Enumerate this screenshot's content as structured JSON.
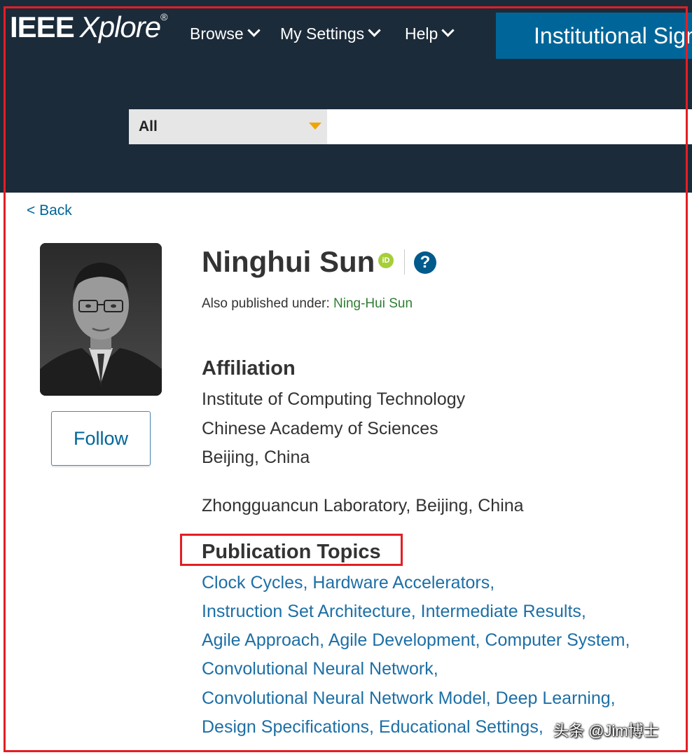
{
  "header": {
    "logo_ieee": "IEEE",
    "logo_xplore": "Xplore",
    "logo_reg": "®",
    "nav": [
      {
        "label": "Browse"
      },
      {
        "label": "My Settings"
      },
      {
        "label": "Help"
      }
    ],
    "institutional_sign_in": "Institutional Sign In",
    "search": {
      "scope_value": "All",
      "query_value": ""
    },
    "colors": {
      "background": "#1c2b3a",
      "accent_button": "#006699",
      "caret": "#f0a500"
    }
  },
  "back_link": "< Back",
  "author": {
    "name": "Ninghui Sun",
    "orcid_label": "iD",
    "help_label": "?",
    "also_published_label": "Also published under:",
    "also_published_name": "Ning-Hui Sun",
    "follow_label": "Follow"
  },
  "affiliation": {
    "heading": "Affiliation",
    "lines": [
      "Institute of Computing Technology",
      "Chinese Academy of Sciences",
      "Beijing, China",
      "Zhongguancun Laboratory, Beijing, China"
    ]
  },
  "publication_topics": {
    "heading": "Publication Topics",
    "lines": [
      "Clock Cycles, Hardware Accelerators,",
      "Instruction Set Architecture, Intermediate Results,",
      "Agile Approach, Agile Development, Computer System,",
      "Convolutional Neural Network,",
      "Convolutional Neural Network Model, Deep Learning,",
      "Design Specifications, Educational Settings,"
    ]
  },
  "watermark": "头条 @Jim博士",
  "annotation_color": "#e31e24"
}
